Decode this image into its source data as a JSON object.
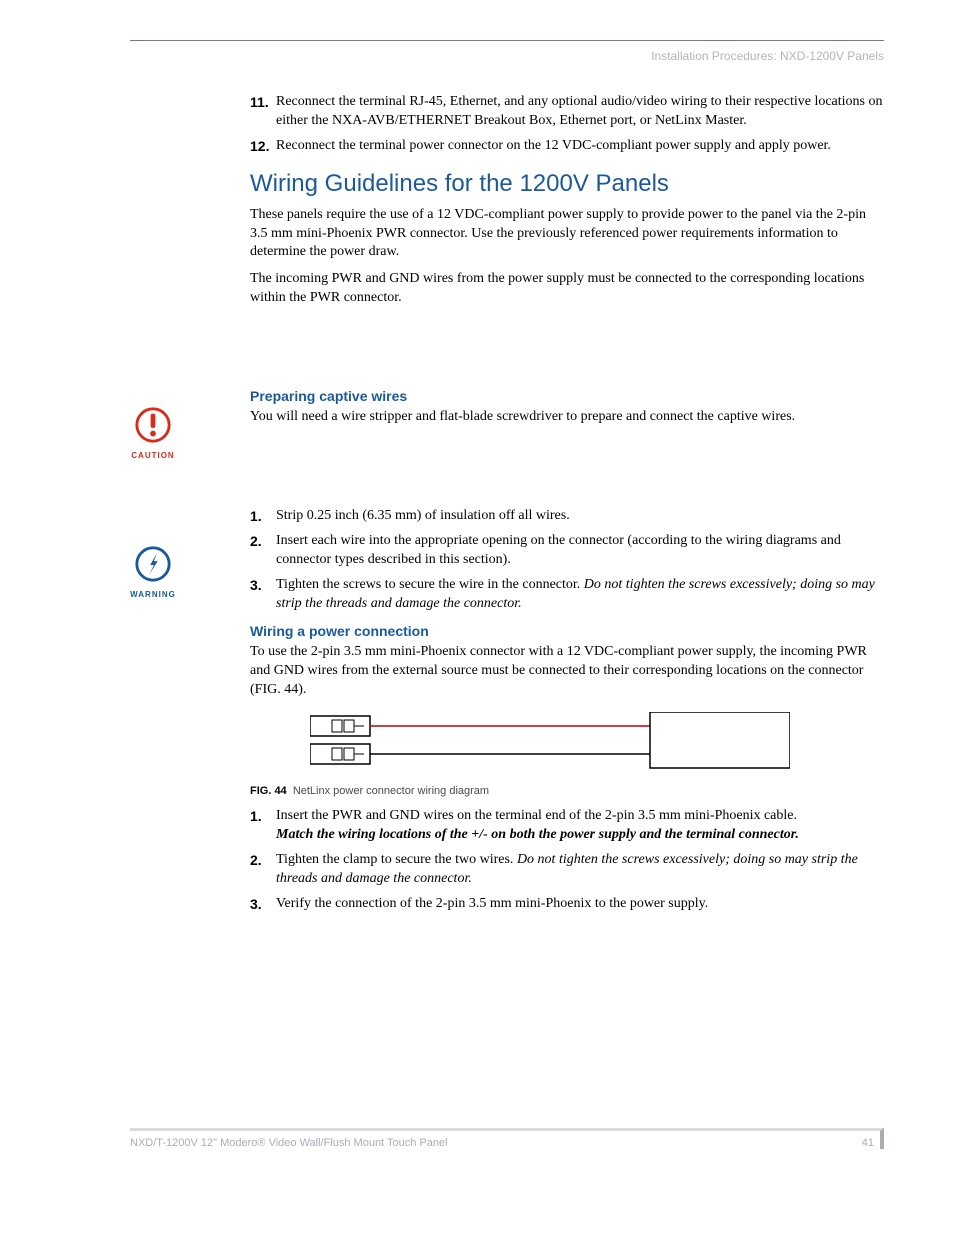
{
  "header": "Installation Procedures: NXD-1200V Panels",
  "steps_top": [
    {
      "n": "11.",
      "t": "Reconnect the terminal RJ-45, Ethernet, and any optional audio/video wiring to their respective locations on either the NXA-AVB/ETHERNET Breakout Box, Ethernet port, or NetLinx Master."
    },
    {
      "n": "12.",
      "t": "Reconnect the terminal power connector on the 12 VDC-compliant power supply and apply power."
    }
  ],
  "h2": "Wiring Guidelines for the 1200V Panels",
  "intro": [
    "These panels require the use of a 12 VDC-compliant power supply to provide power to the panel via the 2-pin 3.5 mm mini-Phoenix PWR connector. Use the previously referenced power requirements information to determine the power draw.",
    "The incoming PWR and GND wires from the power supply must be connected to the corresponding locations within the PWR connector."
  ],
  "caution_label": "CAUTION",
  "warning_label": "WARNING",
  "h3a": "Preparing captive wires",
  "prep_intro": "You will need a wire stripper and flat-blade screwdriver to prepare and connect the captive wires.",
  "prep_steps": [
    {
      "n": "1.",
      "t": "Strip 0.25 inch (6.35 mm) of insulation off all wires."
    },
    {
      "n": "2.",
      "t": "Insert each wire into the appropriate opening on the connector (according to the wiring diagrams and connector types described in this section)."
    },
    {
      "n": "3.",
      "t": "Tighten the screws to secure the wire in the connector. ",
      "em": "Do not tighten the screws excessively; doing so may strip the threads and damage the connector."
    }
  ],
  "h3b": "Wiring a power connection",
  "power_intro": "To use the 2-pin 3.5 mm mini-Phoenix connector with a 12 VDC-compliant power supply, the incoming PWR and GND wires from the external source must be connected to their corresponding locations on the connector (FIG. 44).",
  "fig_num": "FIG. 44",
  "fig_caption": "NetLinx power connector wiring diagram",
  "power_steps": [
    {
      "n": "1.",
      "t": "Insert the PWR and GND wires on the terminal end of the 2-pin 3.5 mm mini-Phoenix cable. ",
      "strong_em": "Match the wiring locations of the +/- on both the power supply and the terminal connector."
    },
    {
      "n": "2.",
      "t": "Tighten the clamp to secure the two wires. ",
      "em": "Do not tighten the screws excessively; doing so may strip the threads and damage the connector."
    },
    {
      "n": "3.",
      "t": "Verify the connection of the 2-pin 3.5 mm mini-Phoenix to the power supply."
    }
  ],
  "footer_left": "NXD/T-1200V 12\" Modero® Video Wall/Flush Mount Touch Panel",
  "footer_right": "41"
}
